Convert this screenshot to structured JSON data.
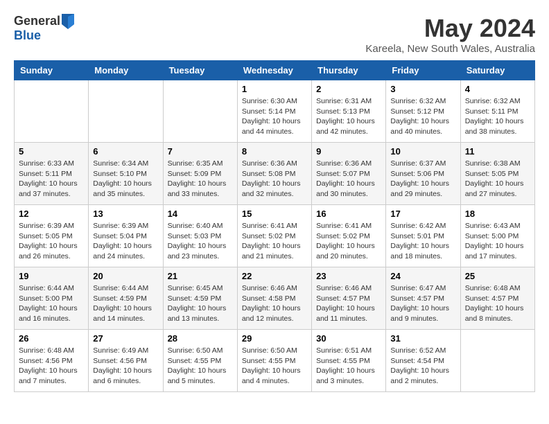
{
  "logo": {
    "general": "General",
    "blue": "Blue"
  },
  "title": "May 2024",
  "location": "Kareela, New South Wales, Australia",
  "days_of_week": [
    "Sunday",
    "Monday",
    "Tuesday",
    "Wednesday",
    "Thursday",
    "Friday",
    "Saturday"
  ],
  "weeks": [
    [
      {
        "day": null,
        "sunrise": null,
        "sunset": null,
        "daylight": null
      },
      {
        "day": null,
        "sunrise": null,
        "sunset": null,
        "daylight": null
      },
      {
        "day": null,
        "sunrise": null,
        "sunset": null,
        "daylight": null
      },
      {
        "day": 1,
        "sunrise": "6:30 AM",
        "sunset": "5:14 PM",
        "daylight": "10 hours and 44 minutes."
      },
      {
        "day": 2,
        "sunrise": "6:31 AM",
        "sunset": "5:13 PM",
        "daylight": "10 hours and 42 minutes."
      },
      {
        "day": 3,
        "sunrise": "6:32 AM",
        "sunset": "5:12 PM",
        "daylight": "10 hours and 40 minutes."
      },
      {
        "day": 4,
        "sunrise": "6:32 AM",
        "sunset": "5:11 PM",
        "daylight": "10 hours and 38 minutes."
      }
    ],
    [
      {
        "day": 5,
        "sunrise": "6:33 AM",
        "sunset": "5:11 PM",
        "daylight": "10 hours and 37 minutes."
      },
      {
        "day": 6,
        "sunrise": "6:34 AM",
        "sunset": "5:10 PM",
        "daylight": "10 hours and 35 minutes."
      },
      {
        "day": 7,
        "sunrise": "6:35 AM",
        "sunset": "5:09 PM",
        "daylight": "10 hours and 33 minutes."
      },
      {
        "day": 8,
        "sunrise": "6:36 AM",
        "sunset": "5:08 PM",
        "daylight": "10 hours and 32 minutes."
      },
      {
        "day": 9,
        "sunrise": "6:36 AM",
        "sunset": "5:07 PM",
        "daylight": "10 hours and 30 minutes."
      },
      {
        "day": 10,
        "sunrise": "6:37 AM",
        "sunset": "5:06 PM",
        "daylight": "10 hours and 29 minutes."
      },
      {
        "day": 11,
        "sunrise": "6:38 AM",
        "sunset": "5:05 PM",
        "daylight": "10 hours and 27 minutes."
      }
    ],
    [
      {
        "day": 12,
        "sunrise": "6:39 AM",
        "sunset": "5:05 PM",
        "daylight": "10 hours and 26 minutes."
      },
      {
        "day": 13,
        "sunrise": "6:39 AM",
        "sunset": "5:04 PM",
        "daylight": "10 hours and 24 minutes."
      },
      {
        "day": 14,
        "sunrise": "6:40 AM",
        "sunset": "5:03 PM",
        "daylight": "10 hours and 23 minutes."
      },
      {
        "day": 15,
        "sunrise": "6:41 AM",
        "sunset": "5:02 PM",
        "daylight": "10 hours and 21 minutes."
      },
      {
        "day": 16,
        "sunrise": "6:41 AM",
        "sunset": "5:02 PM",
        "daylight": "10 hours and 20 minutes."
      },
      {
        "day": 17,
        "sunrise": "6:42 AM",
        "sunset": "5:01 PM",
        "daylight": "10 hours and 18 minutes."
      },
      {
        "day": 18,
        "sunrise": "6:43 AM",
        "sunset": "5:00 PM",
        "daylight": "10 hours and 17 minutes."
      }
    ],
    [
      {
        "day": 19,
        "sunrise": "6:44 AM",
        "sunset": "5:00 PM",
        "daylight": "10 hours and 16 minutes."
      },
      {
        "day": 20,
        "sunrise": "6:44 AM",
        "sunset": "4:59 PM",
        "daylight": "10 hours and 14 minutes."
      },
      {
        "day": 21,
        "sunrise": "6:45 AM",
        "sunset": "4:59 PM",
        "daylight": "10 hours and 13 minutes."
      },
      {
        "day": 22,
        "sunrise": "6:46 AM",
        "sunset": "4:58 PM",
        "daylight": "10 hours and 12 minutes."
      },
      {
        "day": 23,
        "sunrise": "6:46 AM",
        "sunset": "4:57 PM",
        "daylight": "10 hours and 11 minutes."
      },
      {
        "day": 24,
        "sunrise": "6:47 AM",
        "sunset": "4:57 PM",
        "daylight": "10 hours and 9 minutes."
      },
      {
        "day": 25,
        "sunrise": "6:48 AM",
        "sunset": "4:57 PM",
        "daylight": "10 hours and 8 minutes."
      }
    ],
    [
      {
        "day": 26,
        "sunrise": "6:48 AM",
        "sunset": "4:56 PM",
        "daylight": "10 hours and 7 minutes."
      },
      {
        "day": 27,
        "sunrise": "6:49 AM",
        "sunset": "4:56 PM",
        "daylight": "10 hours and 6 minutes."
      },
      {
        "day": 28,
        "sunrise": "6:50 AM",
        "sunset": "4:55 PM",
        "daylight": "10 hours and 5 minutes."
      },
      {
        "day": 29,
        "sunrise": "6:50 AM",
        "sunset": "4:55 PM",
        "daylight": "10 hours and 4 minutes."
      },
      {
        "day": 30,
        "sunrise": "6:51 AM",
        "sunset": "4:55 PM",
        "daylight": "10 hours and 3 minutes."
      },
      {
        "day": 31,
        "sunrise": "6:52 AM",
        "sunset": "4:54 PM",
        "daylight": "10 hours and 2 minutes."
      },
      {
        "day": null,
        "sunrise": null,
        "sunset": null,
        "daylight": null
      }
    ]
  ],
  "labels": {
    "sunrise": "Sunrise:",
    "sunset": "Sunset:",
    "daylight": "Daylight:"
  }
}
